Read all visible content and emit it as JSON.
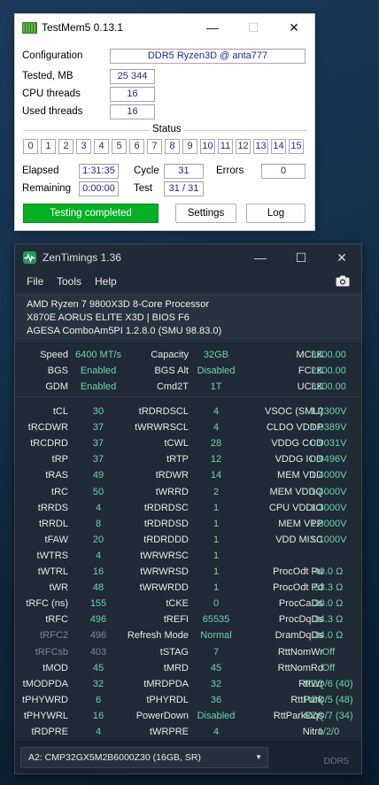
{
  "testmem": {
    "title": "TestMem5  0.13.1",
    "config_label": "Configuration",
    "config_value": "DDR5 Ryzen3D @ anta777",
    "tested_label": "Tested, MB",
    "tested_value": "25 344",
    "cpu_threads_label": "CPU threads",
    "cpu_threads_value": "16",
    "used_threads_label": "Used threads",
    "used_threads_value": "16",
    "status_label": "Status",
    "status_cells": [
      "0",
      "1",
      "2",
      "3",
      "4",
      "5",
      "6",
      "7",
      "8",
      "9",
      "10",
      "11",
      "12",
      "13",
      "14",
      "15"
    ],
    "elapsed_label": "Elapsed",
    "elapsed_value": "1:31:35",
    "cycle_label": "Cycle",
    "cycle_value": "31",
    "errors_label": "Errors",
    "errors_value": "0",
    "remaining_label": "Remaining",
    "remaining_value": "0:00:00",
    "test_label": "Test",
    "test_value": "31 / 31",
    "status_text": "Testing completed",
    "settings_button": "Settings",
    "log_button": "Log"
  },
  "zen": {
    "title": "ZenTimings 1.36",
    "menu": [
      "File",
      "Tools",
      "Help"
    ],
    "cpu": "AMD Ryzen 7 9800X3D 8-Core Processor",
    "board": "X870E AORUS ELITE X3D | BIOS F6",
    "agesa": "AGESA ComboAm5PI 1.2.8.0 (SMU 98.83.0)",
    "top_rows": [
      [
        "Speed",
        "6400 MT/s",
        "Capacity",
        "32GB",
        "MCLK",
        "3200.00"
      ],
      [
        "BGS",
        "Enabled",
        "BGS Alt",
        "Disabled",
        "FCLK",
        "2200.00"
      ],
      [
        "GDM",
        "Enabled",
        "Cmd2T",
        "1T",
        "UCLK",
        "3200.00"
      ]
    ],
    "rows": [
      [
        "tCL",
        "30",
        "tRDRDSCL",
        "4",
        "VSOC (SMU)",
        "1.2300V"
      ],
      [
        "tRCDWR",
        "37",
        "tWRWRSCL",
        "4",
        "CLDO VDDP",
        "1.0389V"
      ],
      [
        "tRCDRD",
        "37",
        "tCWL",
        "28",
        "VDDG CCD",
        "0.9031V"
      ],
      [
        "tRP",
        "37",
        "tRTP",
        "12",
        "VDDG IOD",
        "0.9496V"
      ],
      [
        "tRAS",
        "49",
        "tRDWR",
        "14",
        "MEM VDD",
        "1.4000V"
      ],
      [
        "tRC",
        "50",
        "tWRRD",
        "2",
        "MEM VDDQ",
        "1.4000V"
      ],
      [
        "tRRDS",
        "4",
        "tRDRDSC",
        "1",
        "CPU VDDIO",
        "1.3000V"
      ],
      [
        "tRRDL",
        "8",
        "tRDRDSD",
        "1",
        "MEM VPP",
        "1.8000V"
      ],
      [
        "tFAW",
        "20",
        "tRDRDDD",
        "1",
        "VDD MISC",
        "1.1000V"
      ],
      [
        "tWTRS",
        "4",
        "tWRWRSC",
        "1",
        "",
        ""
      ],
      [
        "tWTRL",
        "16",
        "tWRWRSD",
        "1",
        "ProcOdt Pu",
        "40.0 Ω"
      ],
      [
        "tWR",
        "48",
        "tWRWRDD",
        "1",
        "ProcOdt Pd",
        "53.3 Ω"
      ],
      [
        "tRFC (ns)",
        "155",
        "tCKE",
        "0",
        "ProcCaDs",
        "30.0 Ω"
      ],
      [
        "tRFC",
        "496",
        "tREFI",
        "65535",
        "ProcDqDs",
        "34.3 Ω"
      ],
      [
        "tRFC2",
        "496",
        "Refresh Mode",
        "Normal",
        "DramDqDs",
        "34.0 Ω"
      ],
      [
        "tRFCsb",
        "403",
        "tSTAG",
        "7",
        "RttNomWr",
        "Off"
      ],
      [
        "tMOD",
        "45",
        "tMRD",
        "45",
        "RttNomRd",
        "Off"
      ],
      [
        "tMODPDA",
        "32",
        "tMRDPDA",
        "32",
        "RttWr",
        "RZQ/6 (40)"
      ],
      [
        "tPHYWRD",
        "6",
        "tPHYRDL",
        "36",
        "RttPark",
        "RZQ/5 (48)"
      ],
      [
        "tPHYWRL",
        "16",
        "PowerDown",
        "Disabled",
        "RttParkDqs",
        "RZQ/7 (34)"
      ],
      [
        "tRDPRE",
        "4",
        "tWRPRE",
        "4",
        "Nitro",
        "1/2/0"
      ]
    ],
    "module": "A2: CMP32GX5M2B6000Z30 (16GB, SR)",
    "memtype": "DDR5"
  }
}
